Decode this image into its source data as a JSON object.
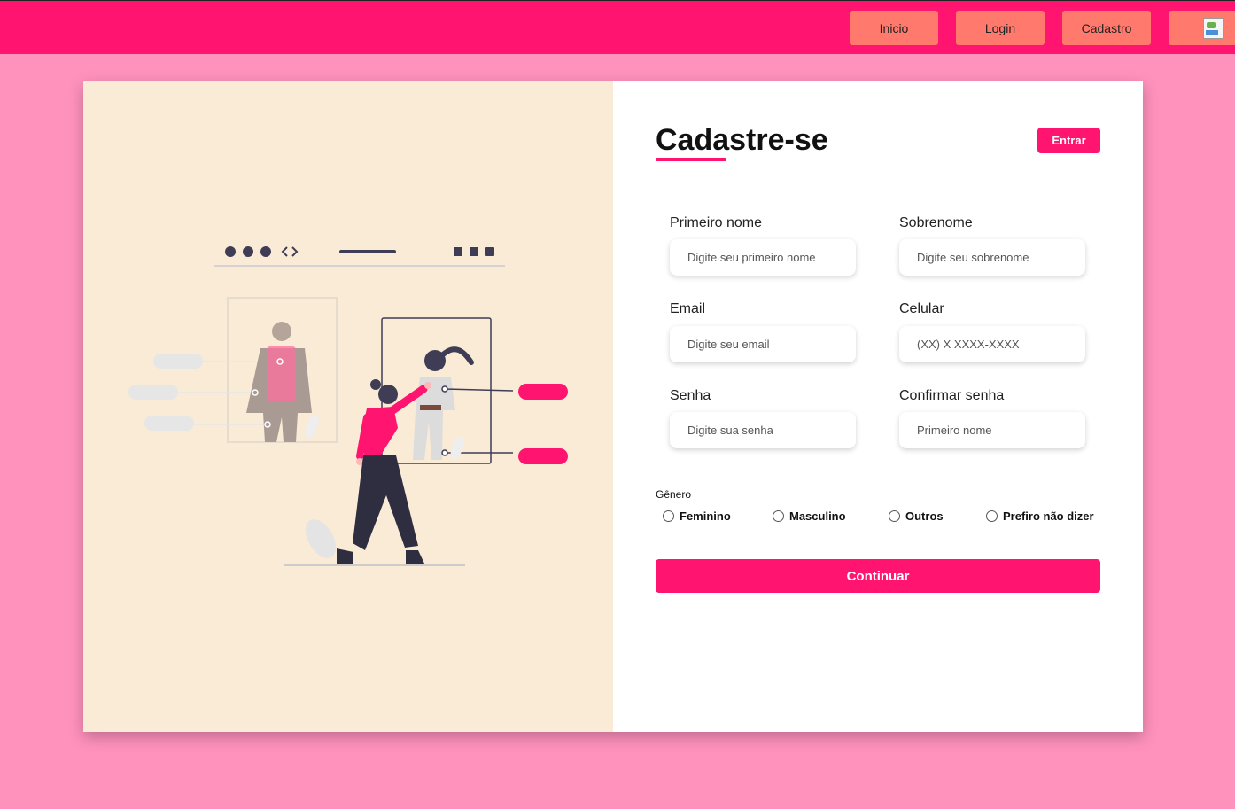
{
  "nav": {
    "items": [
      {
        "label": "Inicio"
      },
      {
        "label": "Login"
      },
      {
        "label": "Cadastro"
      }
    ]
  },
  "form": {
    "title": "Cadastre-se",
    "enter_label": "Entrar",
    "fields": [
      {
        "label": "Primeiro nome",
        "placeholder": "Digite seu primeiro nome"
      },
      {
        "label": "Sobrenome",
        "placeholder": "Digite seu sobrenome"
      },
      {
        "label": "Email",
        "placeholder": "Digite seu email"
      },
      {
        "label": "Celular",
        "placeholder": "(XX) X XXXX-XXXX"
      },
      {
        "label": "Senha",
        "placeholder": "Digite sua senha"
      },
      {
        "label": "Confirmar senha",
        "placeholder": "Primeiro nome"
      }
    ],
    "gender_label": "Gênero",
    "gender_options": [
      {
        "label": "Feminino"
      },
      {
        "label": "Masculino"
      },
      {
        "label": "Outros"
      },
      {
        "label": "Prefiro não dizer"
      }
    ],
    "continue_label": "Continuar"
  },
  "colors": {
    "page_bg": "#ff92bd",
    "topbar": "#ff156f",
    "nav_button": "#ff7a6c",
    "accent": "#ff156f",
    "illustration_bg": "#faebd7"
  },
  "icons": {
    "nav_image": "broken-image-icon",
    "illustration": "person-selecting-profile-illustration"
  }
}
